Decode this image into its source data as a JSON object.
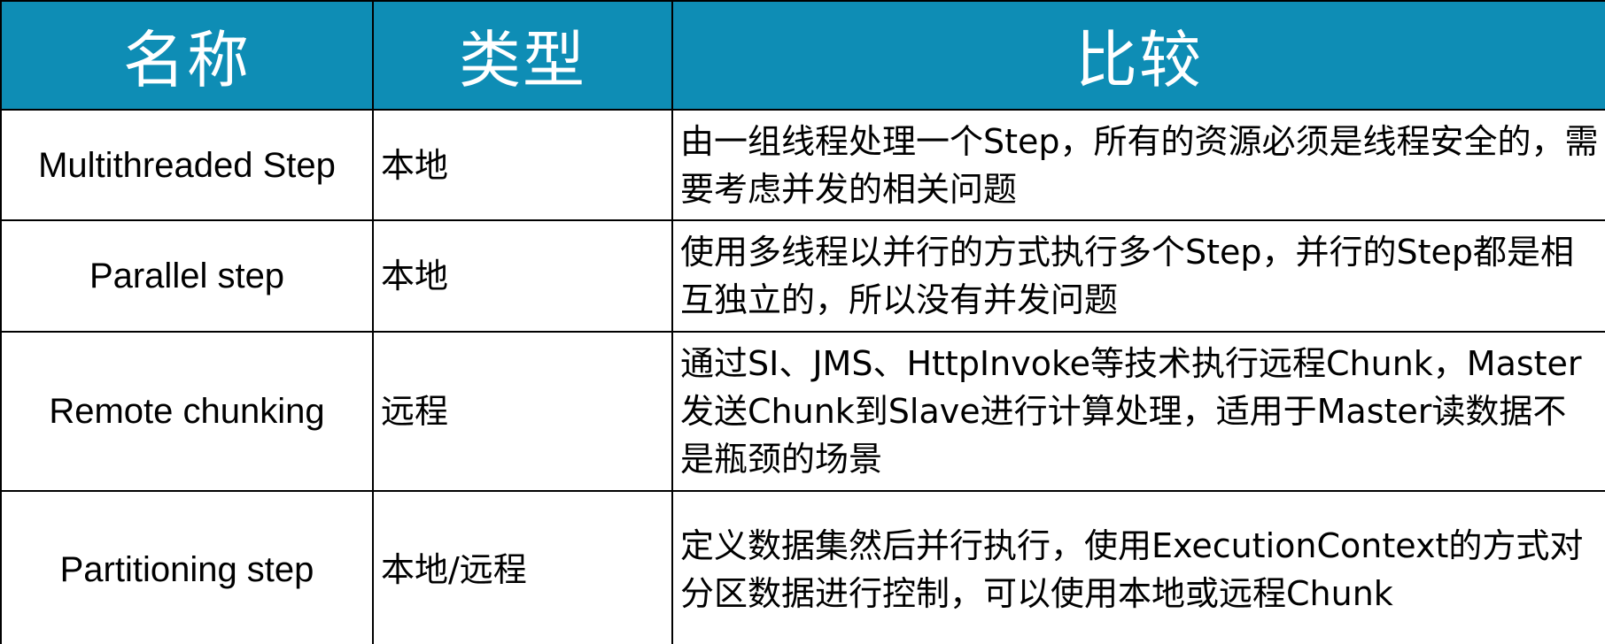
{
  "header": {
    "name": "名称",
    "type": "类型",
    "compare": "比较"
  },
  "rows": [
    {
      "name": "Multithreaded Step",
      "type": "本地",
      "compare": "由一组线程处理一个Step，所有的资源必须是线程安全的，需要考虑并发的相关问题"
    },
    {
      "name": "Parallel step",
      "type": "本地",
      "compare": "使用多线程以并行的方式执行多个Step，并行的Step都是相互独立的，所以没有并发问题"
    },
    {
      "name": "Remote chunking",
      "type": "远程",
      "compare": "通过SI、JMS、HttpInvoke等技术执行远程Chunk，Master发送Chunk到Slave进行计算处理，适用于Master读数据不是瓶颈的场景"
    },
    {
      "name": "Partitioning step",
      "type": "本地/远程",
      "compare": "定义数据集然后并行执行，使用ExecutionContext的方式对分区数据进行控制，可以使用本地或远程Chunk"
    }
  ],
  "colors": {
    "header_bg": "#0e8db5",
    "header_text": "#ffffff",
    "border": "#000000"
  }
}
